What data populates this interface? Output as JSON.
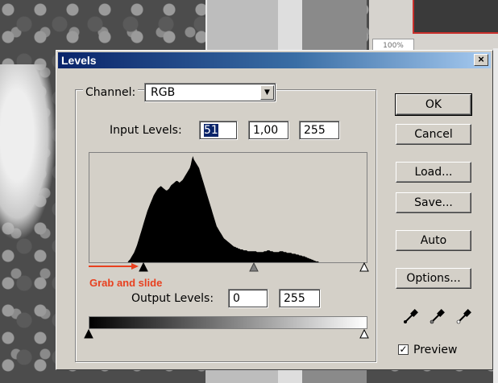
{
  "background": {
    "zoom_text": "100%"
  },
  "dialog": {
    "title": "Levels",
    "close_glyph": "×",
    "channel": {
      "label": "Channel:",
      "value": "RGB"
    },
    "input_levels": {
      "label": "Input Levels:",
      "black": "51",
      "gamma": "1,00",
      "white": "255"
    },
    "output_levels": {
      "label": "Output Levels:",
      "black": "0",
      "white": "255"
    },
    "annotation": "Grab and slide",
    "annotation_color": "#e8401f",
    "buttons": {
      "ok": "OK",
      "cancel": "Cancel",
      "load": "Load...",
      "save": "Save...",
      "auto": "Auto",
      "options": "Options..."
    },
    "eyedroppers": [
      "black-eyedropper-icon",
      "gray-eyedropper-icon",
      "white-eyedropper-icon"
    ],
    "preview": {
      "label": "Preview",
      "checked": true
    }
  },
  "histogram": {
    "bins": 256,
    "peak_bin": 100,
    "heights": [
      0,
      0,
      0,
      0,
      0,
      0,
      0,
      0,
      0,
      0,
      0,
      0,
      0,
      0,
      0,
      0,
      0,
      0,
      0,
      0,
      0,
      0,
      0,
      0,
      0,
      0,
      0,
      0,
      0,
      0,
      0,
      0,
      0,
      0,
      0,
      0,
      0,
      0,
      2,
      3,
      5,
      7,
      9,
      11,
      14,
      17,
      20,
      24,
      28,
      32,
      36,
      40,
      44,
      48,
      52,
      56,
      60,
      63,
      66,
      69,
      72,
      75,
      78,
      80,
      82,
      84,
      86,
      87,
      88,
      89,
      88,
      87,
      86,
      85,
      84,
      84,
      85,
      86,
      88,
      90,
      91,
      92,
      93,
      94,
      95,
      95,
      94,
      93,
      94,
      95,
      96,
      98,
      100,
      102,
      104,
      106,
      108,
      110,
      114,
      120,
      124,
      120,
      118,
      116,
      114,
      112,
      110,
      106,
      102,
      98,
      94,
      90,
      86,
      82,
      78,
      74,
      70,
      66,
      62,
      58,
      54,
      50,
      46,
      42,
      40,
      38,
      36,
      34,
      32,
      30,
      28,
      27,
      26,
      25,
      24,
      23,
      22,
      21,
      20,
      19,
      18,
      18,
      17,
      17,
      16,
      16,
      15,
      15,
      15,
      14,
      14,
      14,
      14,
      13,
      13,
      13,
      13,
      13,
      13,
      13,
      13,
      13,
      12,
      12,
      12,
      12,
      12,
      12,
      12,
      13,
      13,
      13,
      14,
      14,
      14,
      13,
      13,
      13,
      12,
      12,
      12,
      12,
      12,
      12,
      13,
      13,
      13,
      13,
      12,
      12,
      12,
      11,
      11,
      11,
      11,
      11,
      10,
      10,
      10,
      10,
      9,
      9,
      9,
      8,
      8,
      8,
      7,
      7,
      7,
      6,
      6,
      5,
      5,
      4,
      4,
      3,
      3,
      2,
      2,
      1,
      1,
      1,
      0,
      0,
      0,
      0,
      0,
      0,
      0,
      0,
      0,
      0,
      0,
      0,
      0,
      0,
      0,
      0,
      0,
      0,
      0,
      0,
      0,
      0,
      0,
      0,
      0,
      0,
      0,
      0,
      0,
      0,
      0,
      0,
      0,
      0,
      0,
      0,
      0,
      0,
      0,
      0,
      0,
      0,
      0,
      0,
      0,
      0,
      0
    ]
  }
}
